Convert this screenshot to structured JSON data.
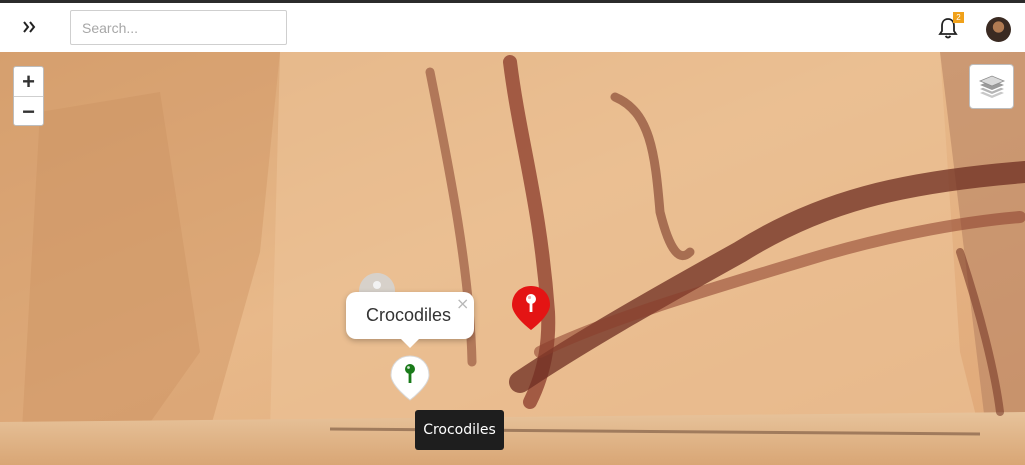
{
  "topbar": {
    "expand_icon": "double-chevron-right-icon",
    "search_placeholder": "Search...",
    "notifications_icon": "bell-icon",
    "notification_count": "2",
    "avatar_icon": "user-avatar"
  },
  "map": {
    "zoom_in_label": "+",
    "zoom_out_label": "−",
    "layers_icon": "layers-icon",
    "colors": {
      "marker_active": "#e41414",
      "marker_green": "#1a7a1a",
      "marker_faded": "#d8d8d8"
    },
    "popup": {
      "text": "Crocodiles",
      "close_label": "×"
    },
    "tooltip": {
      "text": "Crocodiles"
    }
  }
}
